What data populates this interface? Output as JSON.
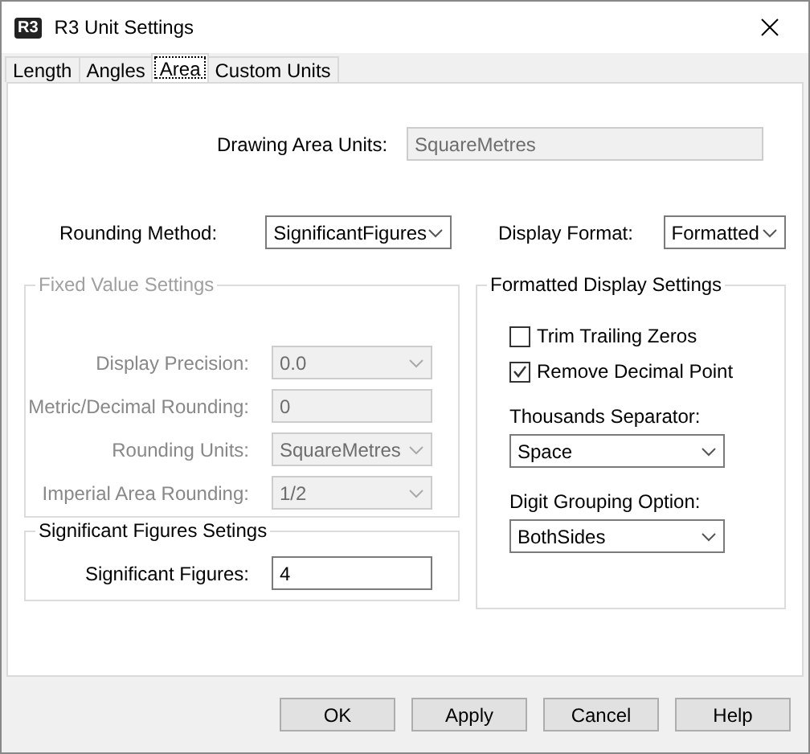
{
  "window": {
    "title": "R3 Unit Settings",
    "logo": "R3"
  },
  "tabs": [
    {
      "label": "Length",
      "selected": false
    },
    {
      "label": "Angles",
      "selected": false
    },
    {
      "label": "Area",
      "selected": true
    },
    {
      "label": "Custom Units",
      "selected": false
    }
  ],
  "drawing_area_units": {
    "label": "Drawing Area Units:",
    "value": "SquareMetres",
    "disabled": true
  },
  "rounding_method": {
    "label": "Rounding Method:",
    "value": "SignificantFigures"
  },
  "display_format": {
    "label": "Display Format:",
    "value": "Formatted"
  },
  "fixed_value_settings": {
    "title": "Fixed Value Settings",
    "disabled": true,
    "fields": [
      {
        "label": "Display Precision:",
        "value": "0.0",
        "kind": "dropdown"
      },
      {
        "label": "Metric/Decimal Rounding:",
        "value": "0",
        "kind": "text"
      },
      {
        "label": "Rounding Units:",
        "value": "SquareMetres",
        "kind": "dropdown"
      },
      {
        "label": "Imperial Area Rounding:",
        "value": "1/2",
        "kind": "dropdown"
      }
    ]
  },
  "significant_figures_settings": {
    "title": "Significant Figures Setings",
    "label": "Significant Figures:",
    "value": "4"
  },
  "formatted_display_settings": {
    "title": "Formatted Display Settings",
    "checkboxes": [
      {
        "label": "Trim Trailing Zeros",
        "checked": false
      },
      {
        "label": "Remove Decimal Point",
        "checked": true
      }
    ],
    "dropdowns": [
      {
        "label": "Thousands Separator:",
        "value": "Space"
      },
      {
        "label": "Digit Grouping Option:",
        "value": "BothSides"
      }
    ]
  },
  "buttons": [
    "OK",
    "Apply",
    "Cancel",
    "Help"
  ]
}
